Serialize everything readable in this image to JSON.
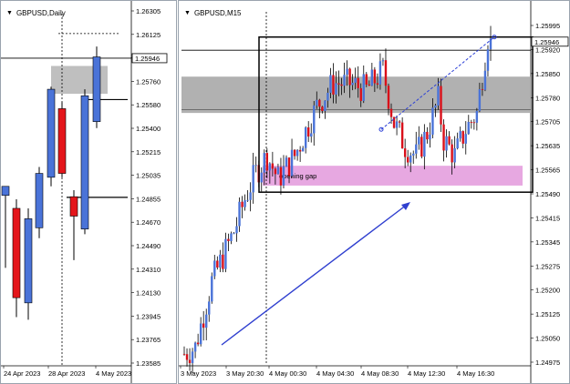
{
  "daily": {
    "title": "GBPUSD,Daily",
    "current_price": "1.25946",
    "price_labels": [
      "1.26305",
      "1.26125",
      "1.25946",
      "1.25760",
      "1.25580",
      "1.25400",
      "1.25215",
      "1.25035",
      "1.24855",
      "1.24670",
      "1.24490",
      "1.24310",
      "1.24130",
      "1.23945",
      "1.23765",
      "1.23585"
    ],
    "date_labels": [
      "24 Apr 2023",
      "28 Apr 2023",
      "4 May 2023"
    ],
    "colors": {
      "bull": "#4a73d8",
      "bear": "#e4161b",
      "wick": "#000000",
      "zone": "#b4b4b4"
    },
    "candles": [
      {
        "o": 1.2488,
        "h": 1.2495,
        "l": 1.2432,
        "c": 1.2495,
        "dir": "bull"
      },
      {
        "o": 1.2478,
        "h": 1.2485,
        "l": 1.2394,
        "c": 1.2409,
        "dir": "bear"
      },
      {
        "o": 1.2405,
        "h": 1.2478,
        "l": 1.2392,
        "c": 1.247,
        "dir": "bull"
      },
      {
        "o": 1.2463,
        "h": 1.251,
        "l": 1.2455,
        "c": 1.2505,
        "dir": "bull"
      },
      {
        "o": 1.2502,
        "h": 1.2572,
        "l": 1.2495,
        "c": 1.257,
        "dir": "bull"
      },
      {
        "o": 1.2555,
        "h": 1.256,
        "l": 1.2502,
        "c": 1.2505,
        "dir": "bear"
      },
      {
        "o": 1.2487,
        "h": 1.2492,
        "l": 1.2438,
        "c": 1.2472,
        "dir": "bear"
      },
      {
        "o": 1.2462,
        "h": 1.257,
        "l": 1.2458,
        "c": 1.2565,
        "dir": "bull"
      },
      {
        "o": 1.2545,
        "h": 1.2603,
        "l": 1.254,
        "c": 1.2595,
        "dir": "bull"
      }
    ]
  },
  "m15": {
    "title": "GBPUSD,M15",
    "current_price": "1.25946",
    "price_labels": [
      "1.25995",
      "1.25920",
      "1.25850",
      "1.25780",
      "1.25705",
      "1.25635",
      "1.25565",
      "1.25490",
      "1.25415",
      "1.25345",
      "1.25275",
      "1.25200",
      "1.25125",
      "1.25050",
      "1.24975"
    ],
    "date_labels": [
      "3 May 2023",
      "3 May 20:30",
      "4 May 00:30",
      "4 May 04:30",
      "4 May 08:30",
      "4 May 12:30",
      "4 May 16:30"
    ],
    "annotation": "opening gap",
    "colors": {
      "bull": "#4a73d8",
      "bear": "#d9101a",
      "wick": "#000000",
      "zone": "#a8a8a8",
      "gap": "#e6a3df",
      "arrow": "#2f3fcf",
      "trend": "#2b3fd6",
      "box": "#000000"
    }
  }
}
